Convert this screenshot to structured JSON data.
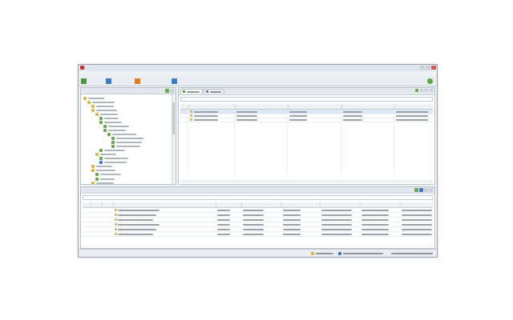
{
  "window": {
    "title": ""
  },
  "menus": [
    "",
    "",
    "",
    "",
    "",
    "",
    ""
  ],
  "toolbar": {
    "buttons": [
      {
        "label": "",
        "color": "#4a9a3a"
      },
      {
        "label": "",
        "color": "#3c78c8"
      },
      {
        "label": "",
        "color": "#e07b28"
      },
      {
        "label": "",
        "color": "#3a7fc4"
      }
    ],
    "user_label": ""
  },
  "left_pane": {
    "title": ""
  },
  "right_pane": {
    "tabs": [
      "",
      ""
    ],
    "filter_placeholder": ""
  },
  "grid_columns": [
    "",
    "",
    "",
    "",
    "",
    ""
  ],
  "bottom_pane": {
    "title": "",
    "filter_placeholder": "",
    "columns": [
      "",
      "",
      "",
      "",
      "",
      "",
      "",
      "",
      "",
      ""
    ]
  },
  "status": [
    "",
    "",
    ""
  ],
  "colors": {
    "accent": "#4a9a3a",
    "folder": "#d9b84a",
    "node": "#6aa84f",
    "selection": "#dde8f6"
  }
}
